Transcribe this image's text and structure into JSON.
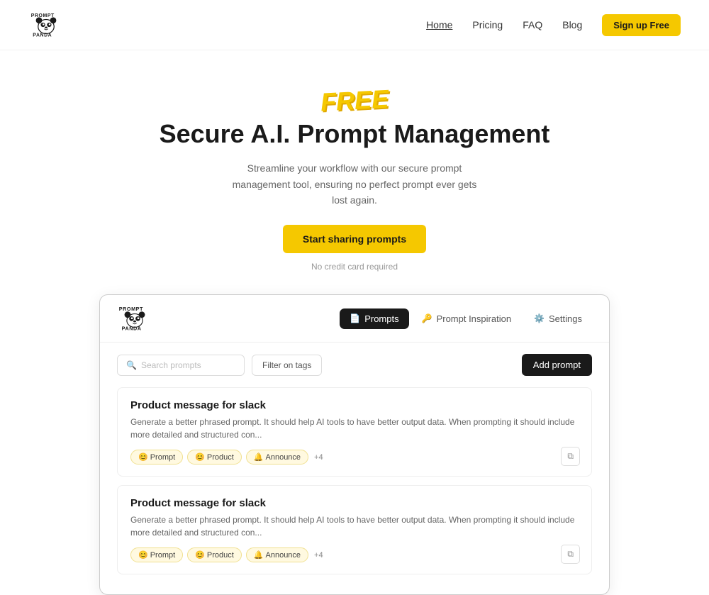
{
  "nav": {
    "links": [
      {
        "label": "Home",
        "active": true
      },
      {
        "label": "Pricing",
        "active": false
      },
      {
        "label": "FAQ",
        "active": false
      },
      {
        "label": "Blog",
        "active": false
      }
    ],
    "signup_label": "Sign up Free"
  },
  "hero": {
    "free_badge": "FREE",
    "title": "Secure A.I. Prompt Management",
    "subtitle": "Streamline your workflow with our secure prompt management tool, ensuring no perfect prompt ever gets lost again.",
    "cta_label": "Start sharing prompts",
    "note": "No credit card required"
  },
  "app": {
    "tabs": [
      {
        "label": "Prompts",
        "active": true,
        "icon": "📄"
      },
      {
        "label": "Prompt Inspiration",
        "active": false,
        "icon": "🔑"
      },
      {
        "label": "Settings",
        "active": false,
        "icon": "⚙️"
      }
    ],
    "search_placeholder": "Search prompts",
    "filter_label": "Filter on tags",
    "add_label": "Add prompt",
    "prompts": [
      {
        "title": "Product message for slack",
        "desc": "Generate a better phrased prompt. It should help AI tools to have better output data. When prompting  it should include more detailed and structured con...",
        "tags": [
          {
            "emoji": "😊",
            "label": "Prompt"
          },
          {
            "emoji": "😊",
            "label": "Product"
          },
          {
            "emoji": "🔔",
            "label": "Announce"
          }
        ],
        "extra_tags": "+4"
      },
      {
        "title": "Product message for slack",
        "desc": "Generate a better phrased prompt. It should help AI tools to have better output data. When prompting  it should include more detailed and structured con...",
        "tags": [
          {
            "emoji": "😊",
            "label": "Prompt"
          },
          {
            "emoji": "😊",
            "label": "Product"
          },
          {
            "emoji": "🔔",
            "label": "Announce"
          }
        ],
        "extra_tags": "+4"
      }
    ]
  },
  "colors": {
    "accent": "#f5c800",
    "dark": "#1a1a1a"
  }
}
